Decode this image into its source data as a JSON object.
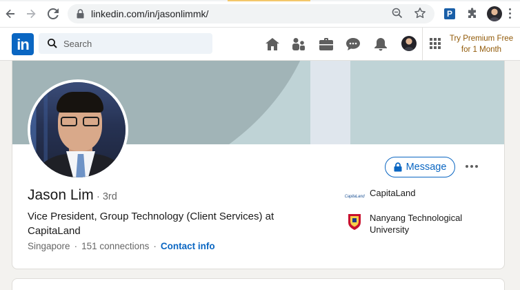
{
  "browser": {
    "url": "linkedin.com/in/jasonlimmk/",
    "extension_letter": "P"
  },
  "header": {
    "logo_text": "in",
    "search_placeholder": "Search",
    "premium_line1": "Try Premium Free",
    "premium_line2": "for 1 Month"
  },
  "profile": {
    "name": "Jason Lim",
    "degree": "· 3rd",
    "headline": "Vice President, Group Technology (Client Services) at CapitaLand",
    "location": "Singapore",
    "connections": "151 connections",
    "contact_info": "Contact info",
    "message_label": "Message",
    "experience": [
      {
        "name": "CapitaLand",
        "logo_text": "CapitaLand"
      },
      {
        "name": "Nanyang Technological University"
      }
    ]
  },
  "colors": {
    "brand": "#0a66c2",
    "premium": "#915907",
    "banner": "#a1b4b7"
  },
  "icons": [
    "back-icon",
    "forward-icon",
    "reload-icon",
    "lock-icon",
    "zoom-icon",
    "star-icon",
    "puzzle-icon",
    "home-icon",
    "my-network-icon",
    "jobs-icon",
    "messaging-icon",
    "notifications-icon",
    "work-grid-icon",
    "more-icon"
  ]
}
